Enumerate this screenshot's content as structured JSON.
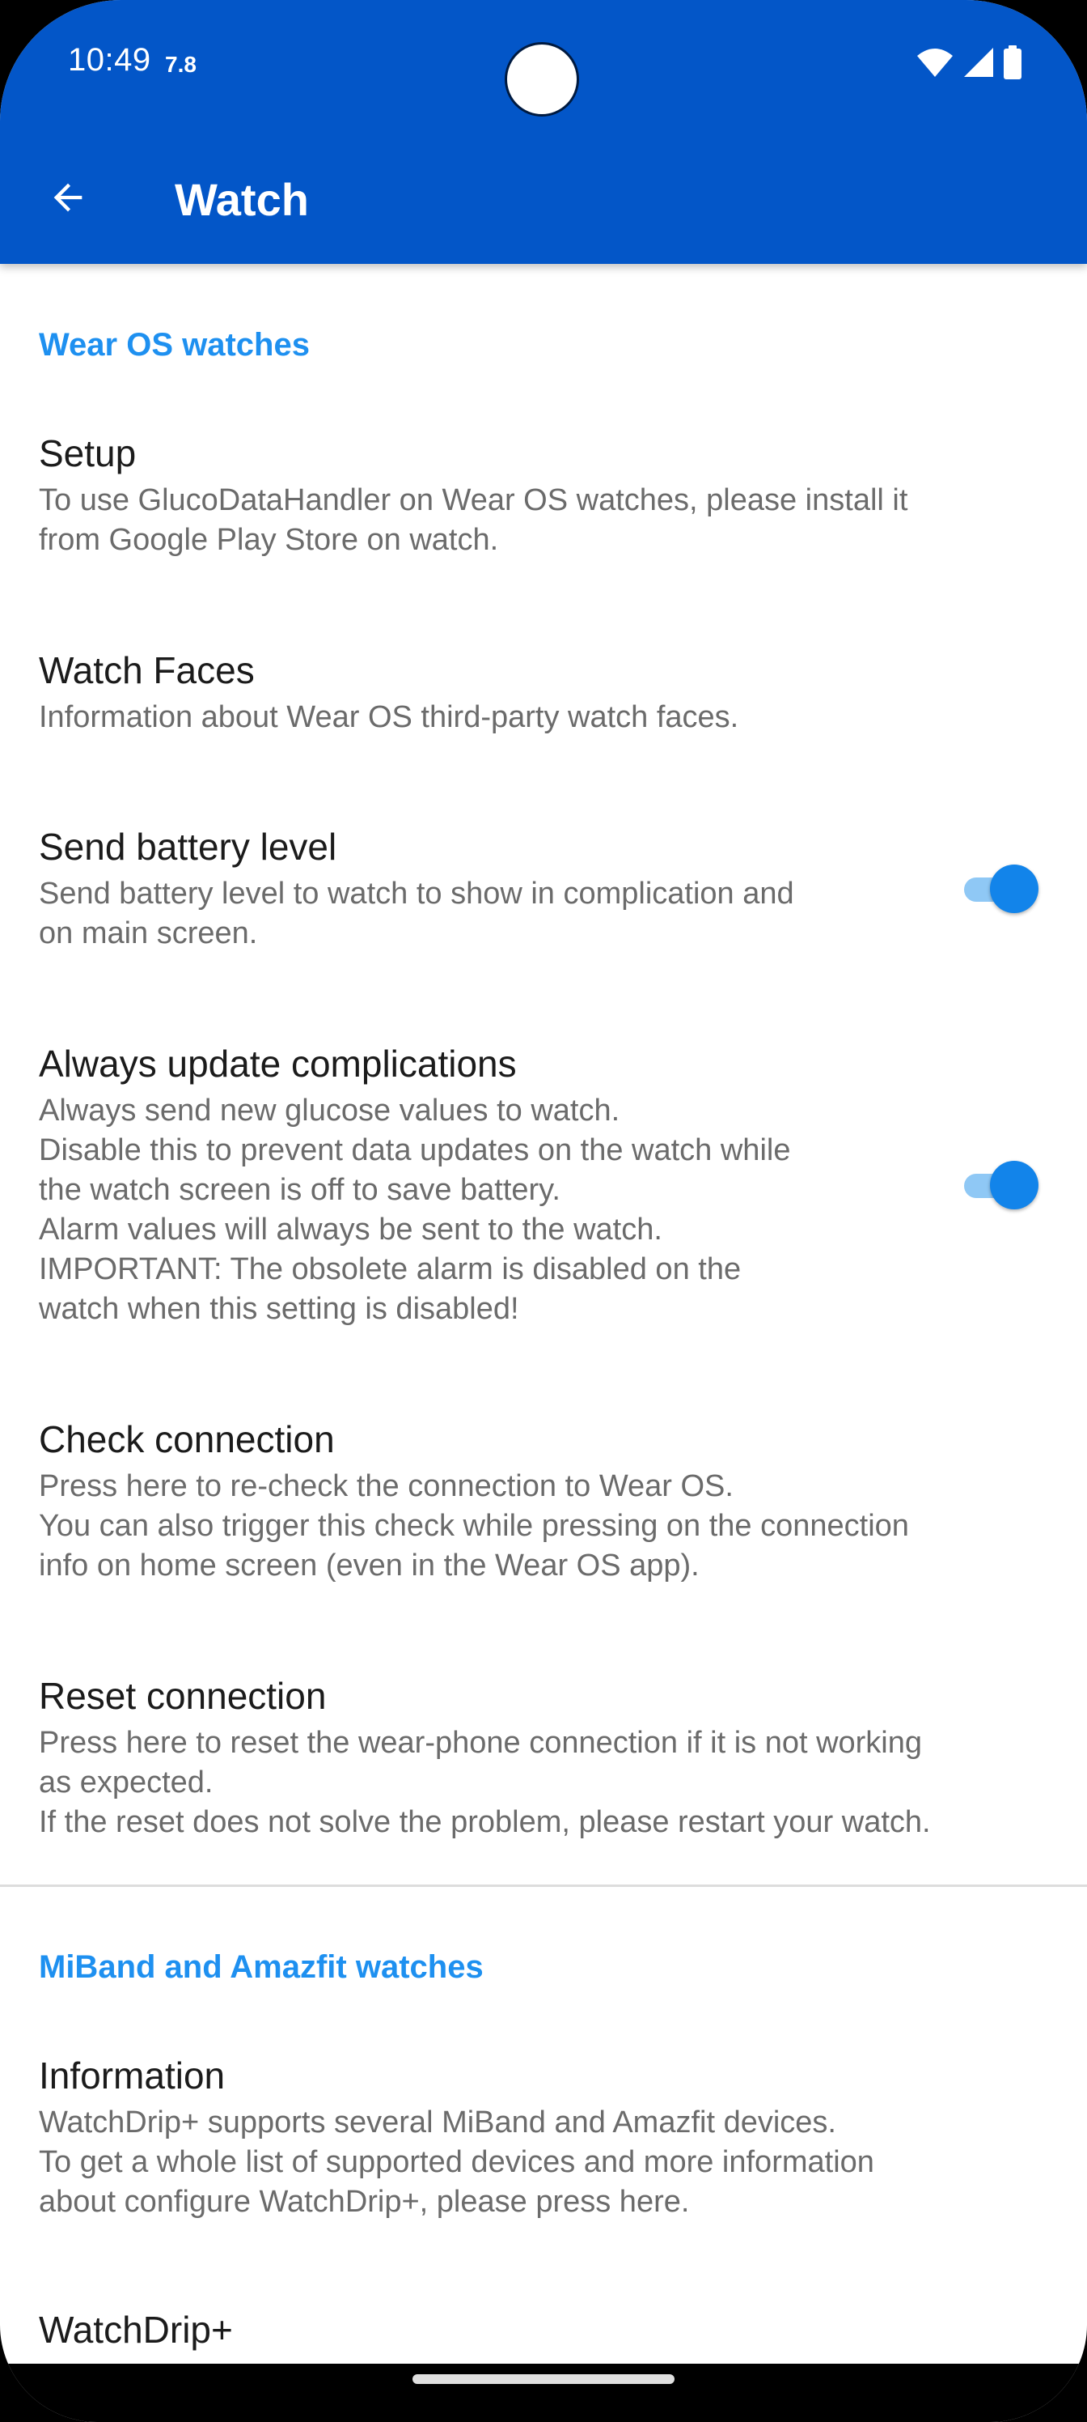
{
  "status_bar": {
    "time": "10:49",
    "extra": "7.8",
    "icons": [
      "wifi-icon",
      "signal-icon",
      "battery-icon"
    ]
  },
  "app_bar": {
    "back_icon": "arrow-back-icon",
    "title": "Watch",
    "color": "#0356c8"
  },
  "colors": {
    "category": "#1e90f0",
    "switch_on": "#1284ea",
    "title_text": "#1b1b1b",
    "summary_text": "#6b6b6b"
  },
  "sections": [
    {
      "category": "Wear OS watches",
      "items": [
        {
          "title": "Setup",
          "summary": "To use GlucoDataHandler on Wear OS watches, please install it\nfrom Google Play Store on watch."
        },
        {
          "title": "Watch Faces",
          "summary": "Information about Wear OS third-party watch faces."
        },
        {
          "title": "Send battery level",
          "summary": "Send battery level to watch to show in complication and\non main screen.",
          "switch_on": true
        },
        {
          "title": "Always update complications",
          "summary": "Always send new glucose values to watch.\nDisable this to prevent data updates on the watch while\nthe watch screen is off to save battery.\nAlarm values will always be sent to the watch.\nIMPORTANT: The obsolete alarm is disabled on the\nwatch when this setting is disabled!",
          "switch_on": true
        },
        {
          "title": "Check connection",
          "summary": "Press here to re-check the connection to Wear OS.\nYou can also trigger this check while pressing on the connection\ninfo on home screen (even in the Wear OS app)."
        },
        {
          "title": "Reset connection",
          "summary": "Press here to reset the wear-phone connection if it is not working\nas expected.\nIf the reset does not solve the problem, please restart your watch."
        }
      ]
    },
    {
      "category": "MiBand and Amazfit watches",
      "items": [
        {
          "title": "Information",
          "summary": "WatchDrip+ supports several MiBand and Amazfit devices.\nTo get a whole list of supported devices and more information\nabout configure WatchDrip+, please press here."
        },
        {
          "title": "WatchDrip+"
        }
      ]
    }
  ]
}
